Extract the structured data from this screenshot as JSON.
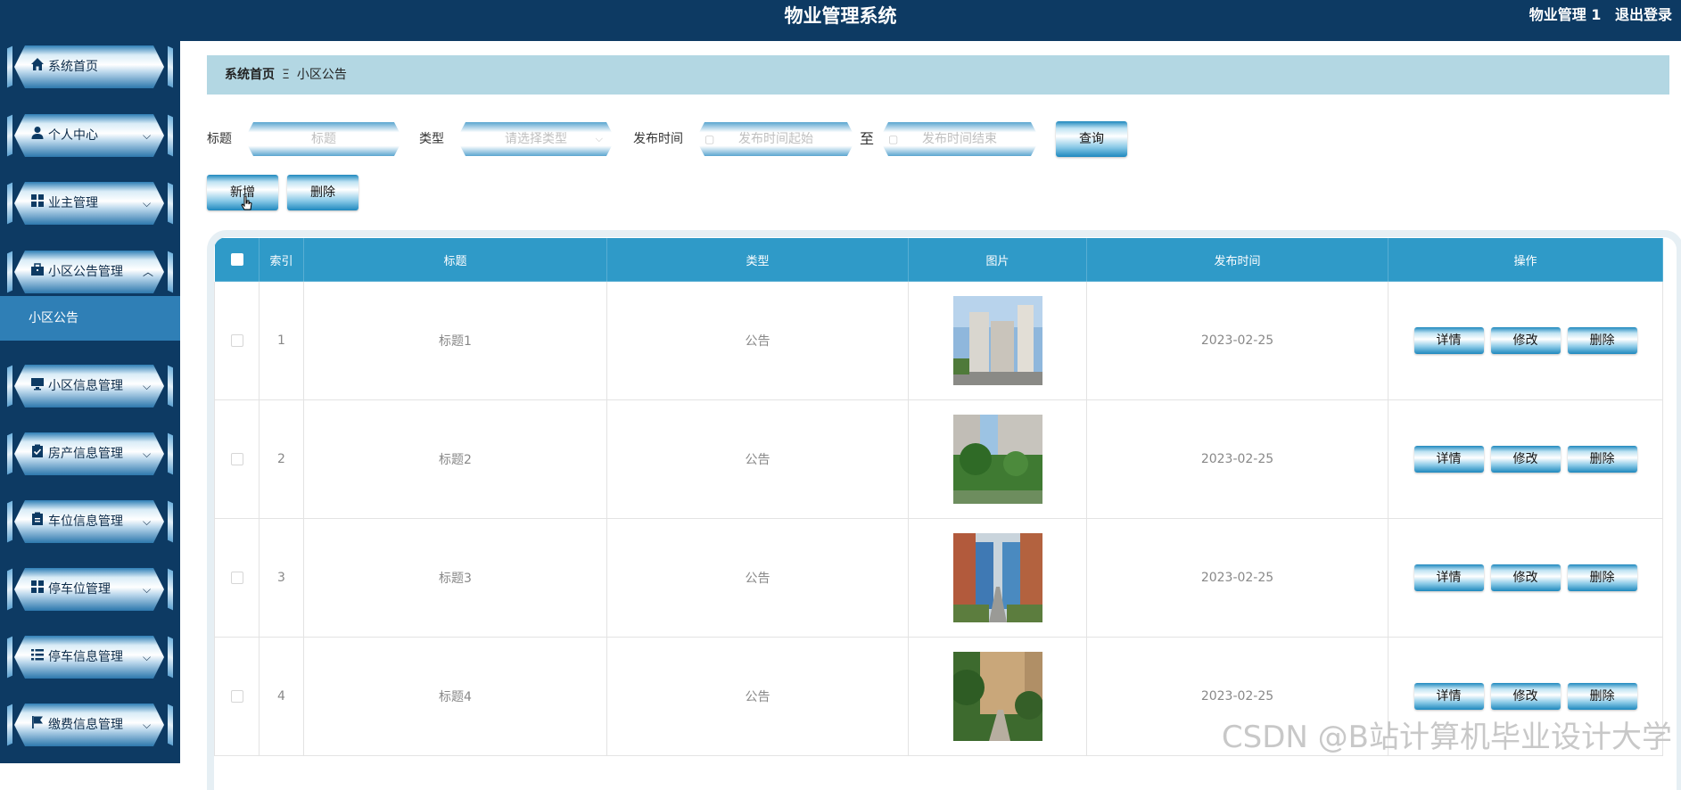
{
  "header": {
    "title": "物业管理系统",
    "user": "物业管理 1",
    "logout": "退出登录"
  },
  "sidebar": {
    "items": [
      {
        "label": "系统首页",
        "icon": "home-icon",
        "caret": false
      },
      {
        "label": "个人中心",
        "icon": "user-icon",
        "caret": true
      },
      {
        "label": "业主管理",
        "icon": "grid-icon",
        "caret": true
      },
      {
        "label": "小区公告管理",
        "icon": "briefcase-icon",
        "caret": true,
        "expanded": true
      },
      {
        "label": "小区信息管理",
        "icon": "monitor-icon",
        "caret": true
      },
      {
        "label": "房产信息管理",
        "icon": "clipboard-check-icon",
        "caret": true
      },
      {
        "label": "车位信息管理",
        "icon": "clipboard-icon",
        "caret": true
      },
      {
        "label": "停车位管理",
        "icon": "grid-icon",
        "caret": true
      },
      {
        "label": "停车信息管理",
        "icon": "list-icon",
        "caret": true
      },
      {
        "label": "缴费信息管理",
        "icon": "flag-icon",
        "caret": true
      }
    ],
    "submenu": {
      "label": "小区公告"
    }
  },
  "breadcrumb": {
    "home": "系统首页",
    "separator": "Ξ",
    "current": "小区公告"
  },
  "search": {
    "title_label": "标题",
    "title_placeholder": "标题",
    "type_label": "类型",
    "type_placeholder": "请选择类型",
    "time_label": "发布时间",
    "time_start_placeholder": "发布时间起始",
    "to": "至",
    "time_end_placeholder": "发布时间结束",
    "query_button": "查询"
  },
  "actions": {
    "add": "新增",
    "delete": "删除"
  },
  "table": {
    "headers": [
      "索引",
      "标题",
      "类型",
      "图片",
      "发布时间",
      "操作"
    ],
    "rows": [
      {
        "index": "1",
        "title": "标题1",
        "type": "公告",
        "time": "2023-02-25"
      },
      {
        "index": "2",
        "title": "标题2",
        "type": "公告",
        "time": "2023-02-25"
      },
      {
        "index": "3",
        "title": "标题3",
        "type": "公告",
        "time": "2023-02-25"
      },
      {
        "index": "4",
        "title": "标题4",
        "type": "公告",
        "time": "2023-02-25"
      }
    ],
    "row_buttons": {
      "detail": "详情",
      "edit": "修改",
      "delete": "删除"
    }
  },
  "watermark": "CSDN @B站计算机毕业设计大学",
  "colors": {
    "navy": "#0d3a63",
    "accent_blue": "#2f9ac8",
    "breadcrumb_bg": "#b3d7e3"
  }
}
